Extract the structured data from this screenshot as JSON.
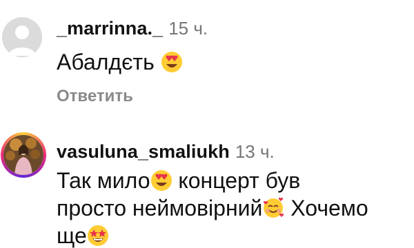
{
  "comments": [
    {
      "username": "_marrinna._",
      "time": "15 ч.",
      "text_parts": [
        "Абалдєть",
        ""
      ],
      "emoji": [
        "heart-eyes"
      ],
      "reply_label": "Ответить",
      "avatar": "default-avatar"
    },
    {
      "username": "vasuluna_smaliukh",
      "time": "13 ч.",
      "line1_a": "Так мило",
      "line1_b": " концерт був",
      "line2_a": "просто неймовірний",
      "line2_b": " Хочемо",
      "line3_a": "ще",
      "emoji": [
        "heart-eyes",
        "smiling-face-with-hearts",
        "star-struck"
      ],
      "avatar": "story-ring-photo"
    }
  ],
  "colors": {
    "text": "#111111",
    "muted": "#767676",
    "reply": "#8a8a8a",
    "avatar_bg": "#dbdbdb",
    "story_ring": [
      "#f9ce34",
      "#ee2a7b",
      "#6228d7"
    ]
  }
}
